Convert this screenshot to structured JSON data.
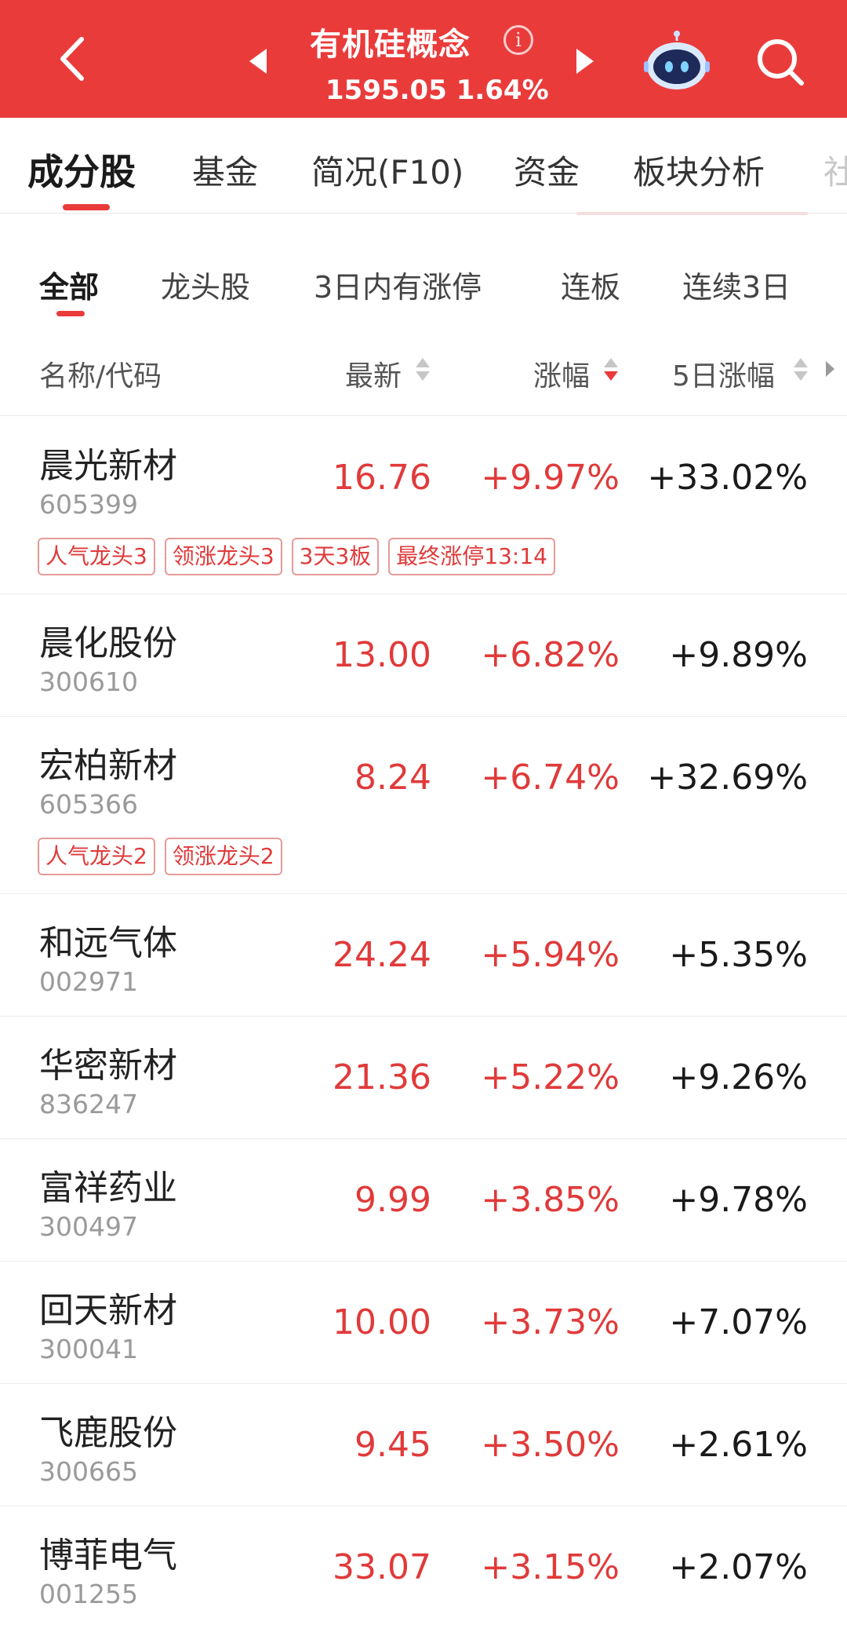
{
  "header": {
    "title": "有机硅概念",
    "index_value": "1595.05",
    "index_change": "1.64%",
    "info_symbol": "i"
  },
  "main_tabs": [
    {
      "label": "成分股",
      "active": true
    },
    {
      "label": "基金"
    },
    {
      "label": "简况(F10)"
    },
    {
      "label": "资金"
    },
    {
      "label": "板块分析"
    },
    {
      "label": "社"
    }
  ],
  "sub_tabs": [
    {
      "label": "全部",
      "active": true
    },
    {
      "label": "龙头股"
    },
    {
      "label": "3日内有涨停"
    },
    {
      "label": "连板"
    },
    {
      "label": "连续3日"
    }
  ],
  "columns": {
    "name": "名称/代码",
    "price": "最新",
    "change": "涨幅",
    "change5d": "5日涨幅",
    "active_sort": "change-desc"
  },
  "stocks": [
    {
      "name": "晨光新材",
      "code": "605399",
      "price": "16.76",
      "change": "+9.97%",
      "change5d": "+33.02%",
      "tags": [
        "人气龙头3",
        "领涨龙头3",
        "3天3板",
        "最终涨停13:14"
      ]
    },
    {
      "name": "晨化股份",
      "code": "300610",
      "price": "13.00",
      "change": "+6.82%",
      "change5d": "+9.89%",
      "tags": []
    },
    {
      "name": "宏柏新材",
      "code": "605366",
      "price": "8.24",
      "change": "+6.74%",
      "change5d": "+32.69%",
      "tags": [
        "人气龙头2",
        "领涨龙头2"
      ]
    },
    {
      "name": "和远气体",
      "code": "002971",
      "price": "24.24",
      "change": "+5.94%",
      "change5d": "+5.35%",
      "tags": []
    },
    {
      "name": "华密新材",
      "code": "836247",
      "price": "21.36",
      "change": "+5.22%",
      "change5d": "+9.26%",
      "tags": []
    },
    {
      "name": "富祥药业",
      "code": "300497",
      "price": "9.99",
      "change": "+3.85%",
      "change5d": "+9.78%",
      "tags": []
    },
    {
      "name": "回天新材",
      "code": "300041",
      "price": "10.00",
      "change": "+3.73%",
      "change5d": "+7.07%",
      "tags": []
    },
    {
      "name": "飞鹿股份",
      "code": "300665",
      "price": "9.45",
      "change": "+3.50%",
      "change5d": "+2.61%",
      "tags": []
    },
    {
      "name": "博菲电气",
      "code": "001255",
      "price": "33.07",
      "change": "+3.15%",
      "change5d": "+2.07%",
      "tags": []
    }
  ],
  "icons": {
    "back": "chevron-left-icon",
    "prev": "triangle-left-icon",
    "next": "triangle-right-icon",
    "info": "info-icon",
    "assistant": "robot-icon",
    "search": "search-icon",
    "sort": "sort-arrows-icon",
    "more_columns": "triangle-right-icon"
  },
  "colors": {
    "header_bg": "#ea3b3b",
    "rise": "#e03a3a",
    "tag_border": "#e79a9a",
    "text_primary": "#222222",
    "text_secondary": "#9a9a9a"
  }
}
